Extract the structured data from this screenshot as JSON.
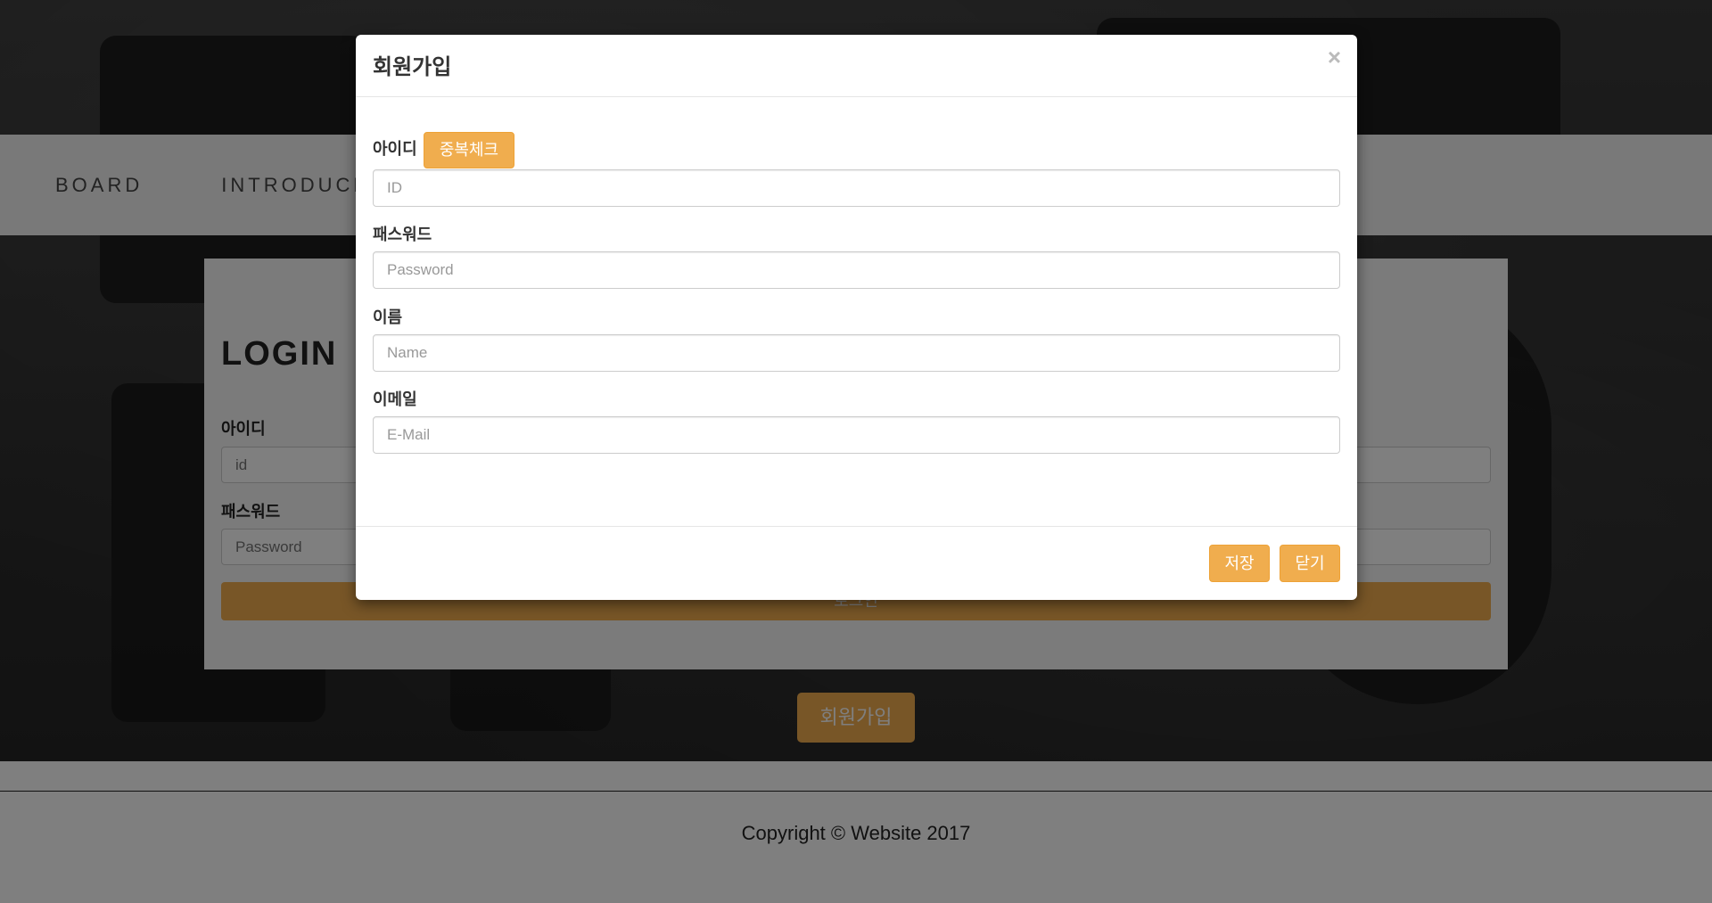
{
  "nav": {
    "items": [
      "BOARD",
      "INTRODUCE"
    ]
  },
  "login": {
    "title": "LOGIN",
    "id_label": "아이디",
    "id_placeholder": "id",
    "pw_label": "패스워드",
    "pw_placeholder": "Password",
    "submit_label": "로그인"
  },
  "signup_button_label": "회원가입",
  "footer": {
    "copyright": "Copyright © Website 2017"
  },
  "modal": {
    "title": "회원가입",
    "close_symbol": "×",
    "id_label": "아이디",
    "dup_check_label": "중복체크",
    "id_placeholder": "ID",
    "pw_label": "패스워드",
    "pw_placeholder": "Password",
    "name_label": "이름",
    "name_placeholder": "Name",
    "email_label": "이메일",
    "email_placeholder": "E-Mail",
    "save_label": "저장",
    "close_label": "닫기"
  },
  "colors": {
    "accent": "#f0ad4e",
    "backdrop": "rgba(0,0,0,0.5)"
  }
}
